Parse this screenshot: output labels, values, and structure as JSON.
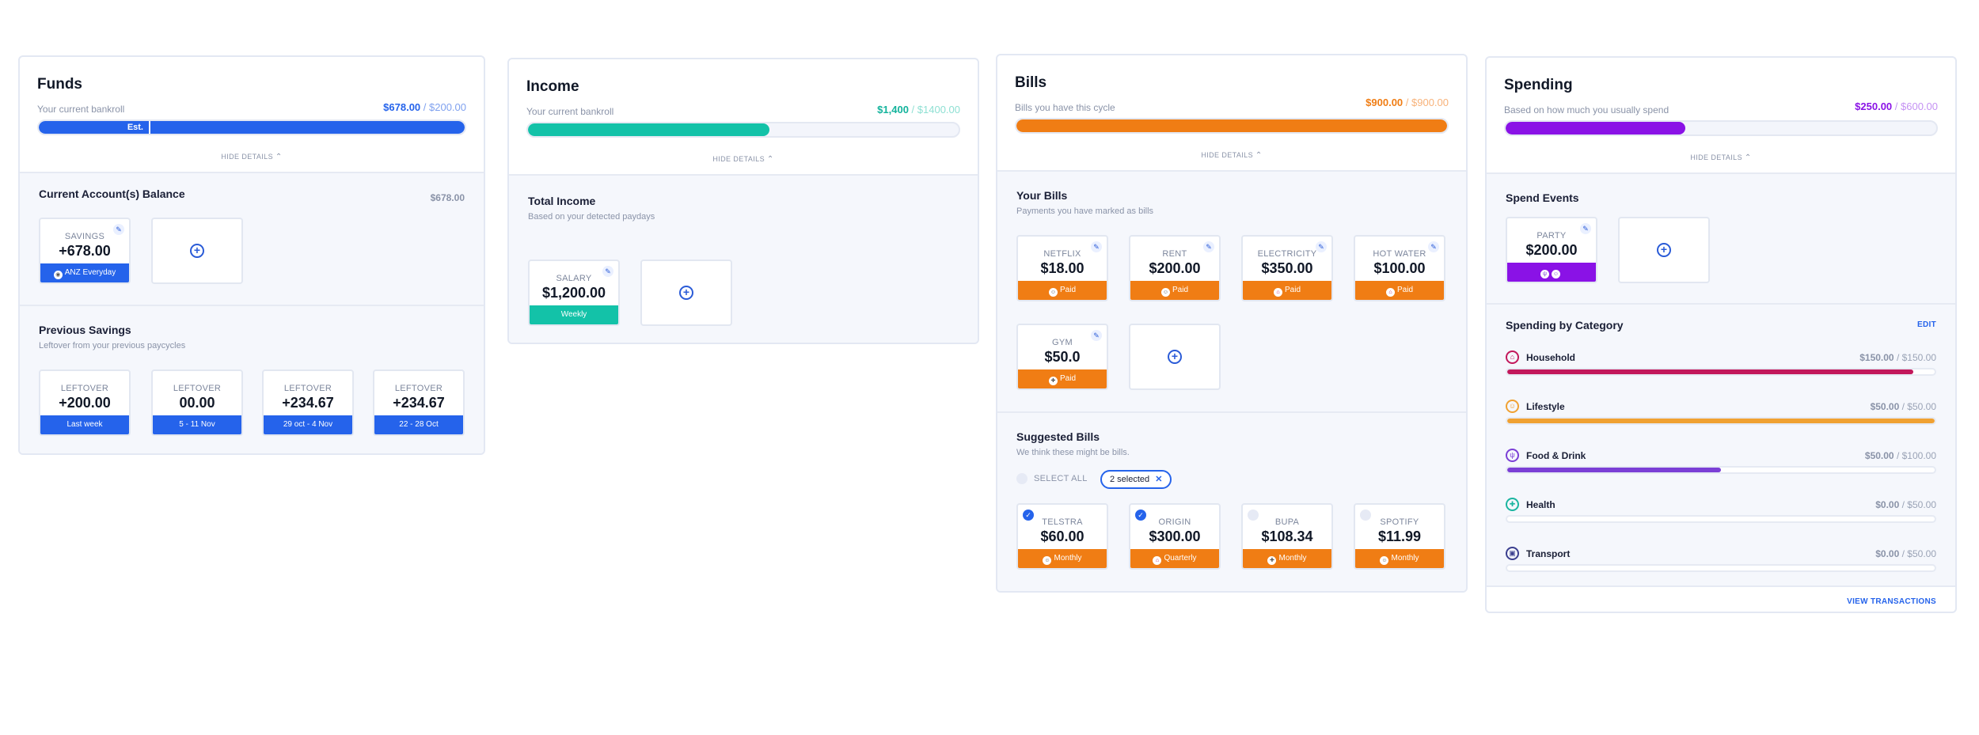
{
  "funds": {
    "title": "Funds",
    "subtitle": "Your current bankroll",
    "amount": "$678.00",
    "total": "/ $200.00",
    "bar_marker": "Est.",
    "progress": 1.0,
    "hide_details": "HIDE DETAILS",
    "current_title": "Current Account(s) Balance",
    "current_amount": "$678.00",
    "savings_card": {
      "label": "SAVINGS",
      "value": "+678.00",
      "footer": "ANZ Everyday"
    },
    "previous_title": "Previous Savings",
    "previous_subtitle": "Leftover from your previous paycycles",
    "leftovers": [
      {
        "label": "LEFTOVER",
        "value": "+200.00",
        "footer": "Last week"
      },
      {
        "label": "LEFTOVER",
        "value": "00.00",
        "footer": "5 - 11 Nov"
      },
      {
        "label": "LEFTOVER",
        "value": "+234.67",
        "footer": "29 oct - 4 Nov"
      },
      {
        "label": "LEFTOVER",
        "value": "+234.67",
        "footer": "22 - 28 Oct"
      }
    ]
  },
  "income": {
    "title": "Income",
    "subtitle": "Your current bankroll",
    "amount": "$1,400",
    "total": "/ $1400.00",
    "progress": 0.56,
    "hide_details": "HIDE DETAILS",
    "total_title": "Total Income",
    "total_subtitle": "Based on your detected paydays",
    "salary_card": {
      "label": "SALARY",
      "value": "$1,200.00",
      "footer": "Weekly"
    }
  },
  "bills": {
    "title": "Bills",
    "subtitle": "Bills you have this cycle",
    "amount": "$900.00",
    "total": "/ $900.00",
    "progress": 1.0,
    "hide_details": "HIDE DETAILS",
    "your_title": "Your Bills",
    "your_subtitle": "Payments you have marked as bills",
    "items": [
      {
        "label": "NETFLIX",
        "value": "$18.00",
        "footer": "Paid"
      },
      {
        "label": "RENT",
        "value": "$200.00",
        "footer": "Paid"
      },
      {
        "label": "ELECTRICITY",
        "value": "$350.00",
        "footer": "Paid"
      },
      {
        "label": "HOT WATER",
        "value": "$100.00",
        "footer": "Paid"
      },
      {
        "label": "GYM",
        "value": "$50.0",
        "footer": "Paid"
      }
    ],
    "suggested_title": "Suggested Bills",
    "suggested_subtitle": "We think these might be bills.",
    "select_all": "SELECT ALL",
    "selected_chip": "2 selected",
    "suggested": [
      {
        "label": "TELSTRA",
        "value": "$60.00",
        "footer": "Monthly",
        "checked": true
      },
      {
        "label": "ORIGIN",
        "value": "$300.00",
        "footer": "Quarterly",
        "checked": true
      },
      {
        "label": "BUPA",
        "value": "$108.34",
        "footer": "Monthly",
        "checked": false
      },
      {
        "label": "SPOTIFY",
        "value": "$11.99",
        "footer": "Monthly",
        "checked": false
      }
    ]
  },
  "spending": {
    "title": "Spending",
    "subtitle": "Based on how much you usually spend",
    "amount": "$250.00",
    "total": "/ $600.00",
    "progress": 0.4167,
    "hide_details": "HIDE DETAILS",
    "events_title": "Spend Events",
    "party_card": {
      "label": "PARTY",
      "value": "$200.00"
    },
    "category_title": "Spending by Category",
    "edit": "EDIT",
    "categories": [
      {
        "name": "Household",
        "amount": "$150.00",
        "total": "/ $150.00",
        "progress": 0.95,
        "color": "#c2185b"
      },
      {
        "name": "Lifestyle",
        "amount": "$50.00",
        "total": "/ $50.00",
        "progress": 1.0,
        "color": "#f0a132"
      },
      {
        "name": "Food & Drink",
        "amount": "$50.00",
        "total": "/ $100.00",
        "progress": 0.5,
        "color": "#7b3fd6"
      },
      {
        "name": "Health",
        "amount": "$0.00",
        "total": "/ $50.00",
        "progress": 0,
        "color": "#1bb5a0"
      },
      {
        "name": "Transport",
        "amount": "$0.00",
        "total": "/ $50.00",
        "progress": 0,
        "color": "#3b3f8f"
      }
    ],
    "view_transactions": "VIEW TRANSACTIONS"
  },
  "colors": {
    "blue": "#2563eb",
    "teal": "#13c2a8",
    "orange": "#f07d14",
    "purple": "#8a12e6"
  }
}
